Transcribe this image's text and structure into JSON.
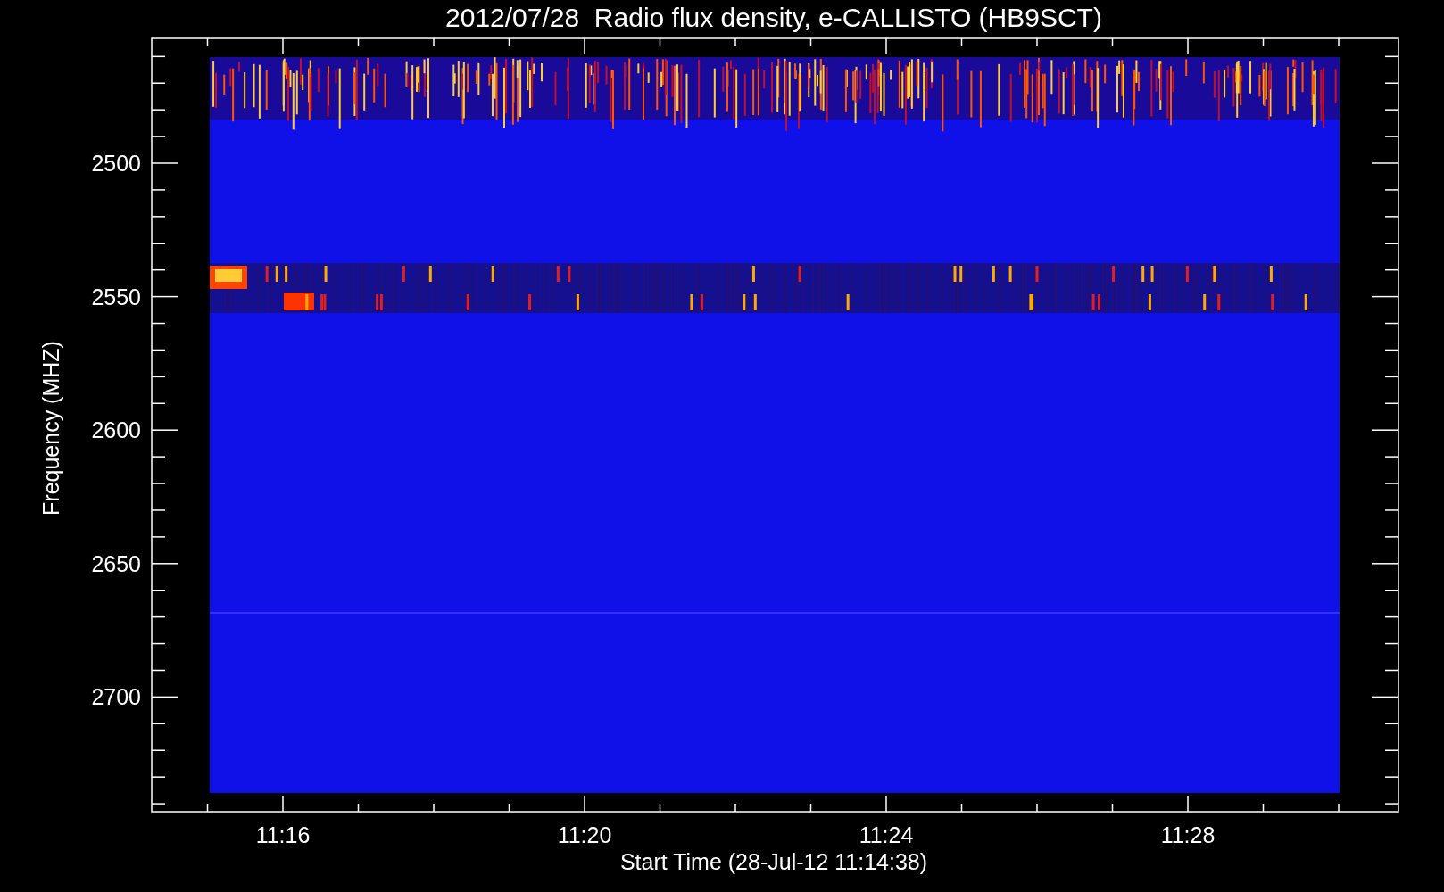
{
  "title": "2012/07/28  Radio flux density, e-CALLISTO (HB9SCT)",
  "yaxis": {
    "label": "Frequency (MHZ)",
    "ticks": [
      "2500",
      "2550",
      "2600",
      "2650",
      "2700"
    ]
  },
  "xaxis": {
    "label": "Start Time (28-Jul-12 11:14:38)",
    "ticks": [
      "11:16",
      "11:20",
      "11:24",
      "11:28"
    ]
  }
}
